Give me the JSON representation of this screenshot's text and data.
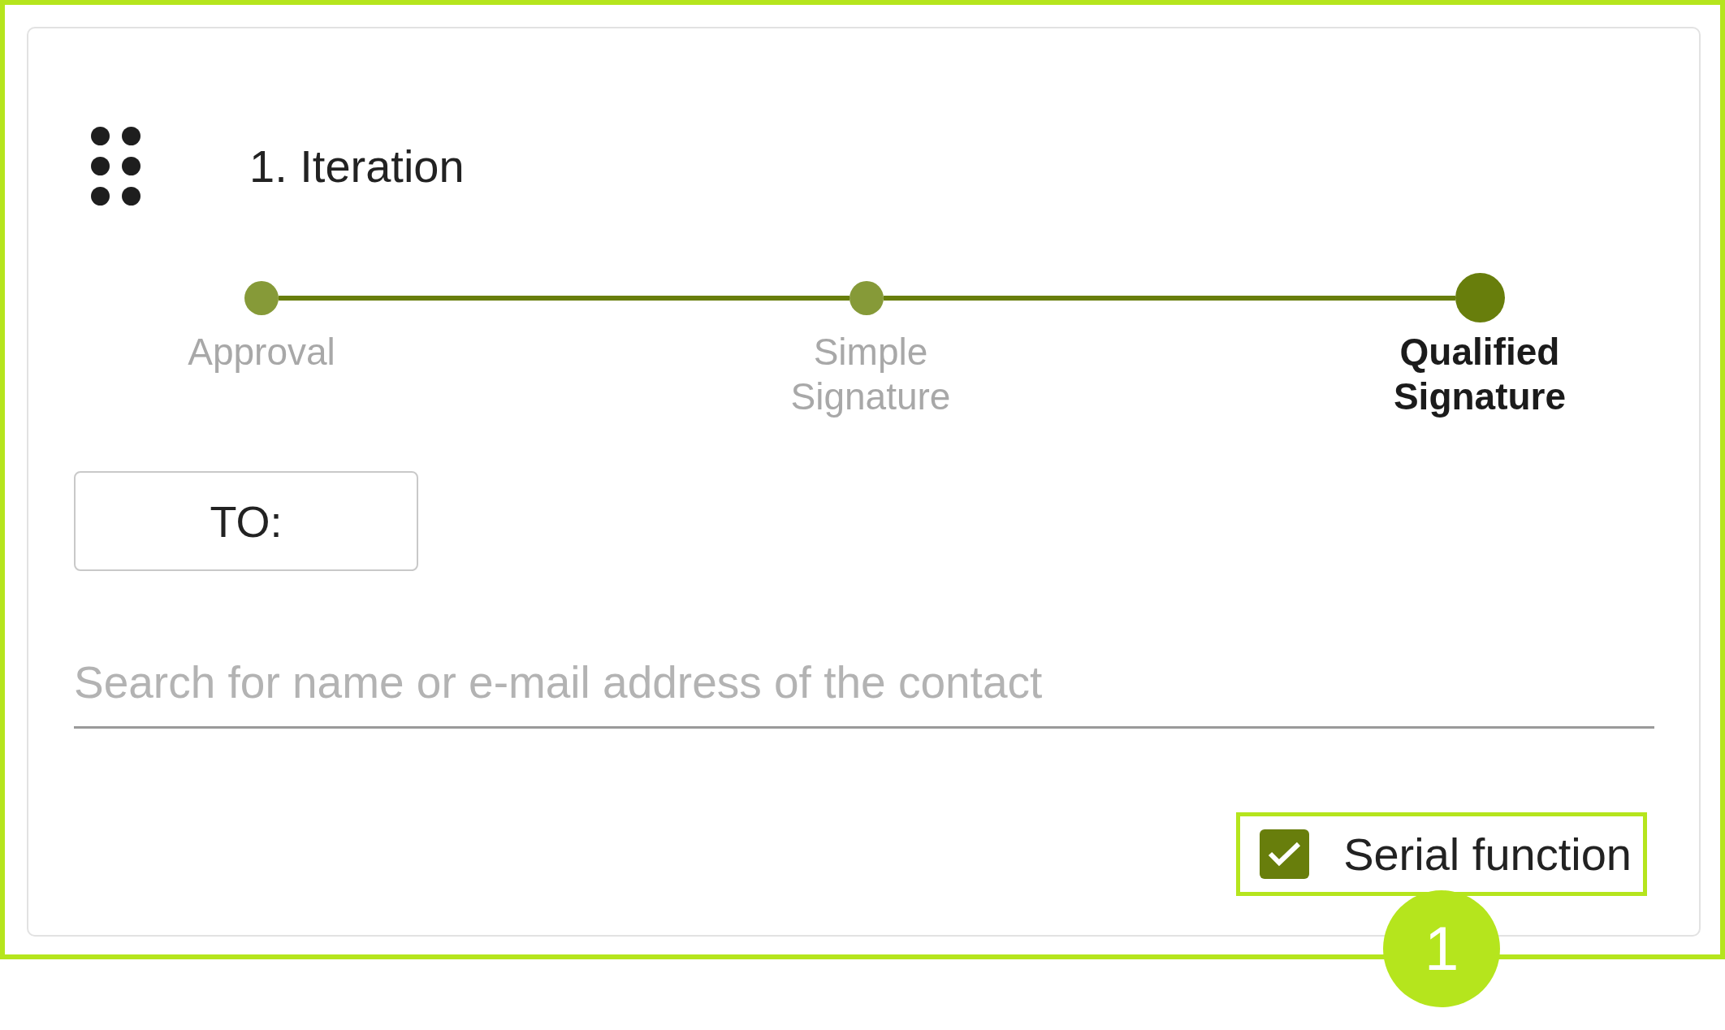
{
  "iteration": {
    "title": "1. Iteration",
    "steps": [
      {
        "label": "Approval",
        "selected": false
      },
      {
        "label": "Simple Signature",
        "selected": false
      },
      {
        "label": "Qualified Signature",
        "selected": true
      }
    ],
    "recipient_button": {
      "label": "TO:"
    },
    "search": {
      "placeholder": "Search for name or e-mail address of the contact"
    },
    "serial_function": {
      "label": "Serial function",
      "checked": true,
      "callout": "1"
    }
  }
}
